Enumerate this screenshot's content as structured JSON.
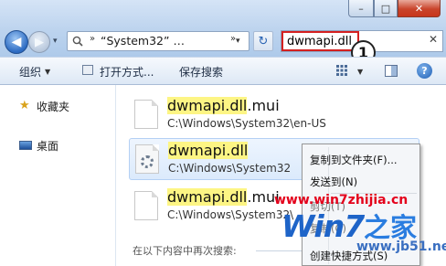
{
  "window": {
    "caption_buttons": {
      "minimize": "–",
      "maximize": "□",
      "close": "✕"
    }
  },
  "address_bar": {
    "back_icon": "back-arrow-icon",
    "forward_icon": "forward-arrow-icon",
    "separator": "»",
    "path": "“System32” …",
    "dropdown_glyph": "▾",
    "refresh_glyph": "↻"
  },
  "search": {
    "value": "dwmapi.dll",
    "clear_glyph": "✕",
    "highlight_color": "#d42020"
  },
  "callout": {
    "number": "1"
  },
  "toolbar": {
    "organize": "组织",
    "open_with": "打开方式...",
    "save_search": "保存搜索",
    "help": "?"
  },
  "nav_pane": {
    "favorites": "收藏夹",
    "desktop": "桌面"
  },
  "results": [
    {
      "name": "dwmapi.dll.mui",
      "highlight": "dwmapi.dll",
      "rest": ".mui",
      "path": "C:\\Windows\\System32\\en-US",
      "icon": "blank-file-icon",
      "selected": false
    },
    {
      "name": "dwmapi.dll",
      "highlight": "dwmapi.dll",
      "rest": "",
      "path": "C:\\Windows\\System32",
      "icon": "dll-file-icon",
      "selected": true
    },
    {
      "name": "dwmapi.dll.mui",
      "highlight": "dwmapi.dll",
      "rest": ".mui",
      "path": "C:\\Windows\\System32\\",
      "icon": "blank-file-icon",
      "selected": false
    }
  ],
  "search_again_label": "在以下内容中再次搜索:",
  "context_menu": {
    "copy_to_folder": "复制到文件夹(F)...",
    "send_to": "发送到(N)",
    "cut": "剪切(T)",
    "copy": "复制(C)",
    "create_shortcut": "创建快捷方式(S)"
  },
  "watermark": {
    "url": "www.win7zhijia.cn",
    "logo": "Win7",
    "logo_cn": "之家",
    "url2": "www.jb51.net"
  },
  "colors": {
    "accent": "#2c6bc2",
    "selection": "#dbeafc",
    "search_highlight": "#fdf584"
  }
}
